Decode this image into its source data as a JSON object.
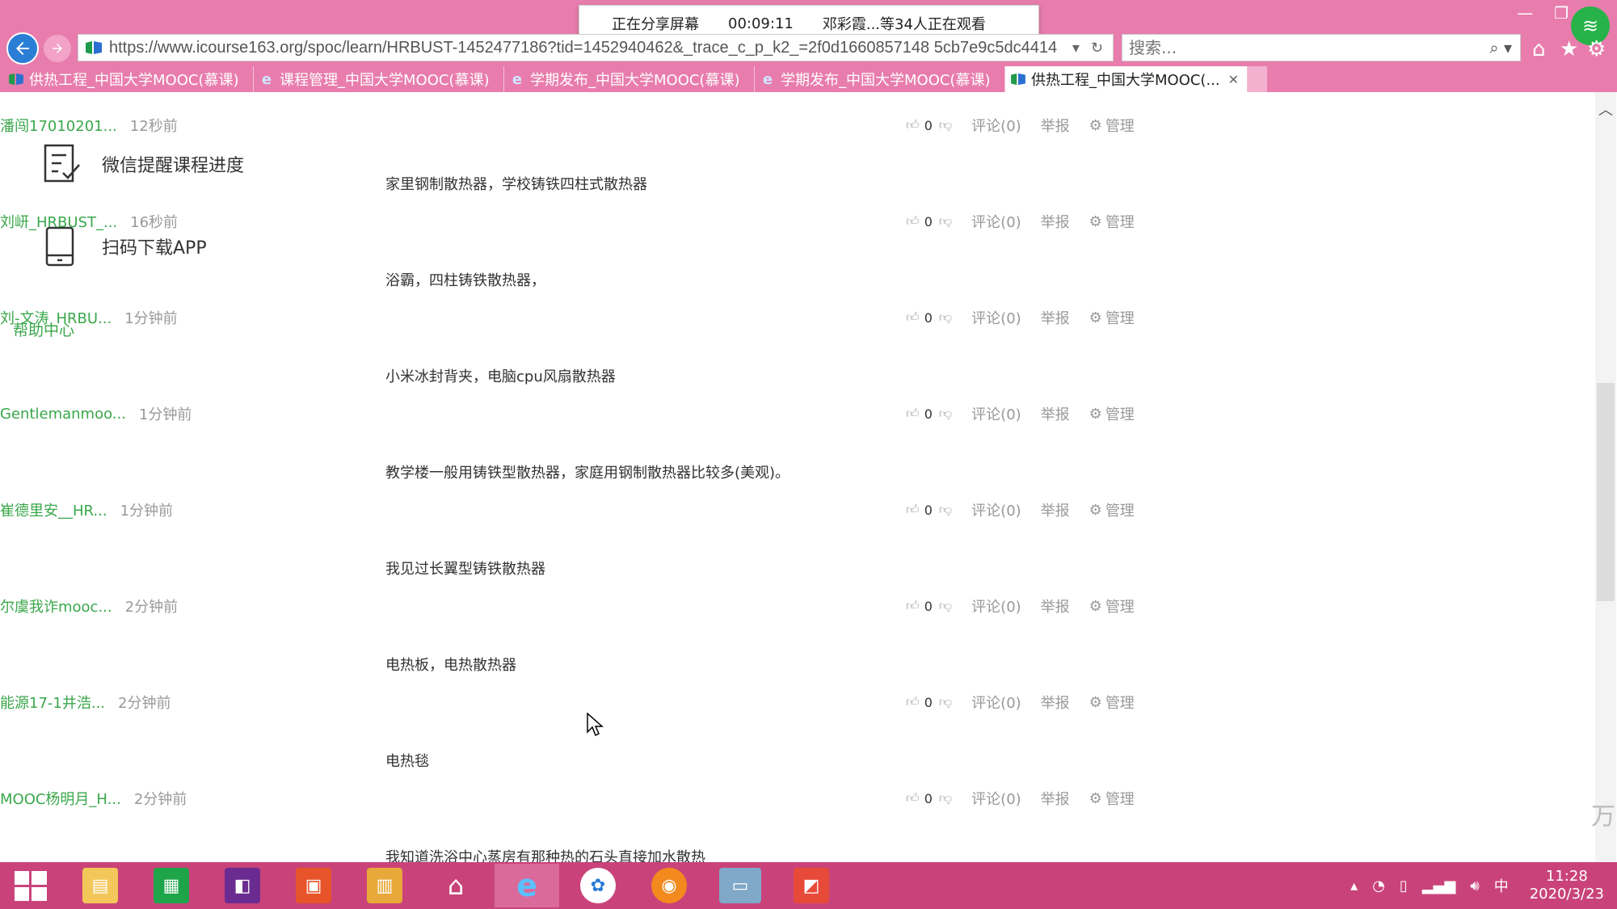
{
  "share_popup": {
    "status": "正在分享屏幕",
    "elapsed": "00:09:11",
    "viewers": "邓彩霞...等34人正在观看"
  },
  "browser": {
    "url": "https://www.icourse163.org/spoc/learn/HRBUST-1452477186?tid=1452940462&_trace_c_p_k2_=2f0d1660857148 5cb7e9c5dc4414",
    "search_placeholder": "搜索...",
    "tabs": [
      {
        "label": "供热工程_中国大学MOOC(慕课)",
        "active": false,
        "icon": "mooc-icon"
      },
      {
        "label": "课程管理_中国大学MOOC(慕课)",
        "active": false,
        "icon": "ie-icon"
      },
      {
        "label": "学期发布_中国大学MOOC(慕课)",
        "active": false,
        "icon": "ie-icon"
      },
      {
        "label": "学期发布_中国大学MOOC(慕课)",
        "active": false,
        "icon": "ie-icon"
      },
      {
        "label": "供热工程_中国大学MOOC(...",
        "active": true,
        "icon": "mooc-icon"
      }
    ]
  },
  "sidebar": {
    "wechat_reminder": "微信提醒课程进度",
    "scan_download": "扫码下载APP",
    "help_center": "帮助中心"
  },
  "comments": [
    {
      "text": "",
      "author": "潘闯17010201...",
      "time": "12秒前",
      "likes": "0"
    },
    {
      "text": "家里钢制散热器，学校铸铁四柱式散热器",
      "author": "刘岍_HRBUST_...",
      "time": "16秒前",
      "likes": "0"
    },
    {
      "text": "浴霸，四柱铸铁散热器，",
      "author": "刘-文涛_HRBU...",
      "time": "1分钟前",
      "likes": "0"
    },
    {
      "text": "小米冰封背夹，电脑cpu风扇散热器",
      "author": "Gentlemanmoo...",
      "time": "1分钟前",
      "likes": "0"
    },
    {
      "text": "教学楼一般用铸铁型散热器，家庭用钢制散热器比较多(美观)。",
      "author": "崔德里安__HR...",
      "time": "1分钟前",
      "likes": "0"
    },
    {
      "text": "我见过长翼型铸铁散热器",
      "author": "尔虞我诈mooc...",
      "time": "2分钟前",
      "likes": "0"
    },
    {
      "text": "电热板，电热散热器",
      "author": "能源17-1井浩...",
      "time": "2分钟前",
      "likes": "0"
    },
    {
      "text": "电热毯",
      "author": "MOOC杨明月_H...",
      "time": "2分钟前",
      "likes": "0"
    },
    {
      "text": "我知道洗浴中心蒸房有那种热的石头直接加水散热",
      "author": "",
      "time": "",
      "likes": ""
    }
  ],
  "actions": {
    "comment": "评论(0)",
    "report": "举报",
    "manage": "管理"
  },
  "taskbar": {
    "time": "11:28",
    "date": "2020/3/23",
    "ime": "中"
  },
  "watermark": "人乃万"
}
